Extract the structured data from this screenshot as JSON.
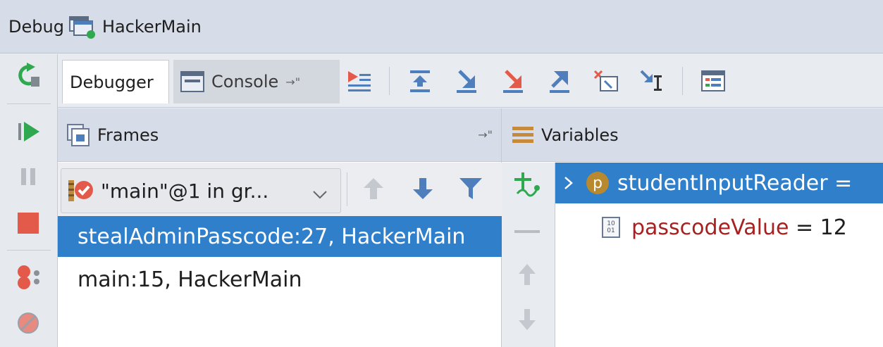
{
  "title_bar": {
    "tool_window": "Debug",
    "config_name": "HackerMain"
  },
  "tabs": {
    "debugger": "Debugger",
    "console": "Console",
    "console_pin": "→\""
  },
  "toolbar_icons": [
    "show-execution-point-icon",
    "step-over-icon",
    "step-into-icon",
    "force-step-into-icon",
    "step-out-icon",
    "drop-frame-icon",
    "run-to-cursor-icon",
    "evaluate-expression-icon"
  ],
  "frames": {
    "header": "Frames",
    "pin": "→\"",
    "thread": "\"main\"@1 in gr...",
    "rows": [
      {
        "label": "stealAdminPasscode:27, HackerMain"
      },
      {
        "label": "main:15, HackerMain"
      }
    ]
  },
  "variables": {
    "header": "Variables",
    "rows": [
      {
        "badge": "p",
        "name": "studentInputReader",
        "eq": " =",
        "value": ""
      },
      {
        "badge": "10 01",
        "name": "passcodeValue",
        "eq": " = ",
        "value": "12"
      }
    ]
  },
  "colors": {
    "selection": "#2f7fca",
    "header": "#d7dde8",
    "var_name": "#a82020"
  }
}
